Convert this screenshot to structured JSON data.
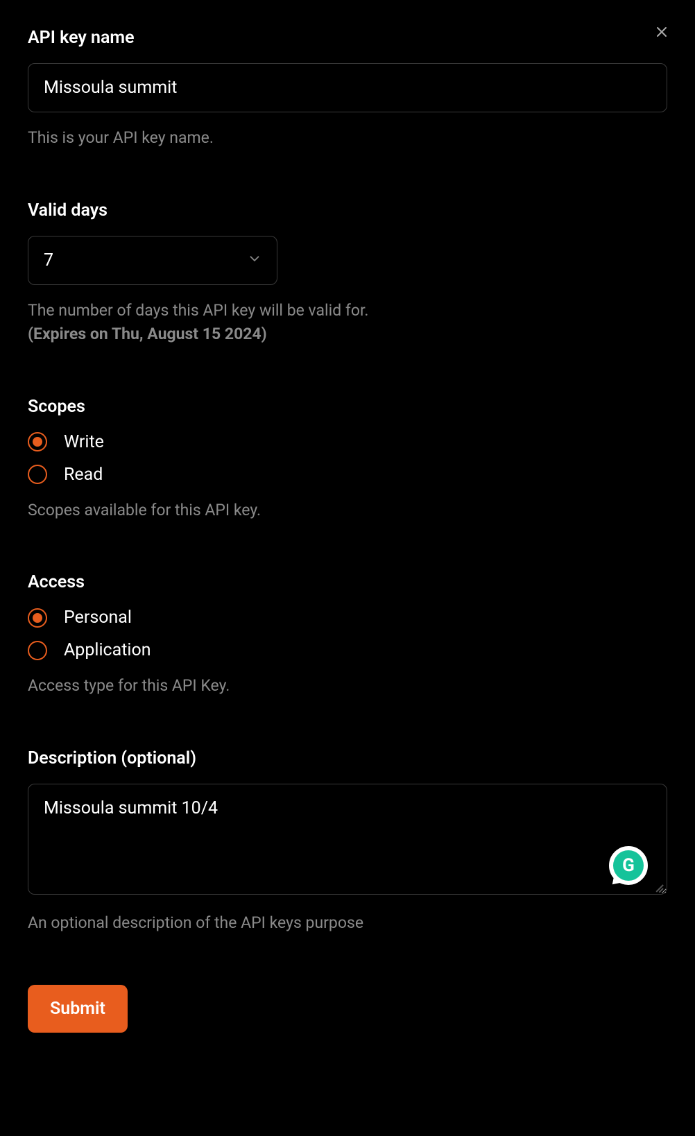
{
  "close": {},
  "api_key_name": {
    "label": "API key name",
    "value": "Missoula summit",
    "helper": "This is your API key name."
  },
  "valid_days": {
    "label": "Valid days",
    "value": "7",
    "helper": "The number of days this API key will be valid for.",
    "expires": "(Expires on Thu, August 15 2024)"
  },
  "scopes": {
    "label": "Scopes",
    "options": [
      {
        "label": "Write",
        "selected": true
      },
      {
        "label": "Read",
        "selected": false
      }
    ],
    "helper": "Scopes available for this API key."
  },
  "access": {
    "label": "Access",
    "options": [
      {
        "label": "Personal",
        "selected": true
      },
      {
        "label": "Application",
        "selected": false
      }
    ],
    "helper": "Access type for this API Key."
  },
  "description": {
    "label": "Description (optional)",
    "value": "Missoula summit 10/4",
    "helper": "An optional description of the API keys purpose"
  },
  "submit": {
    "label": "Submit"
  },
  "grammarly": {
    "letter": "G"
  }
}
